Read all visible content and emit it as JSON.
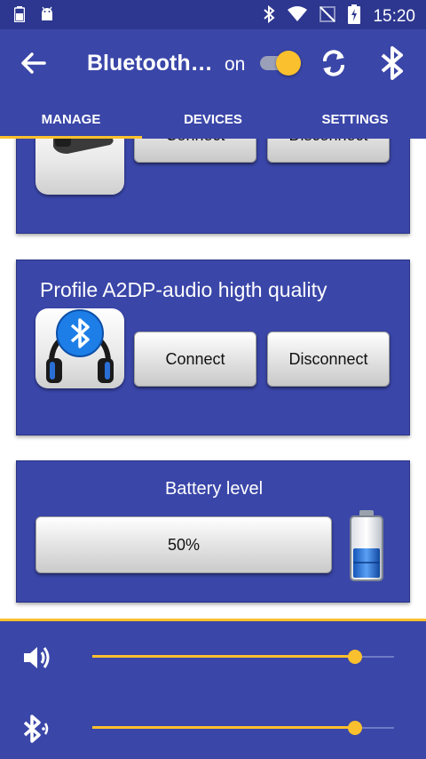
{
  "status_bar": {
    "time": "15:20",
    "icons": [
      "battery-icon",
      "android-icon",
      "bluetooth-icon",
      "wifi-icon",
      "no-sim-icon",
      "charging-battery-icon"
    ]
  },
  "app_bar": {
    "title": "Bluetooth…",
    "power_label": "on",
    "power_on": true,
    "icons": [
      "back-arrow-icon",
      "refresh-icon",
      "bluetooth-icon"
    ]
  },
  "tabs": [
    {
      "label": "MANAGE",
      "selected": true
    },
    {
      "label": "DEVICES",
      "selected": false
    },
    {
      "label": "SETTINGS",
      "selected": false
    }
  ],
  "profiles": [
    {
      "title": "",
      "icon": "headset-icon",
      "connect_label": "Connect",
      "disconnect_label": "Disconnect"
    },
    {
      "title": "Profile A2DP-audio higth quality",
      "icon": "bluetooth-headphones-icon",
      "connect_label": "Connect",
      "disconnect_label": "Disconnect"
    }
  ],
  "battery": {
    "title": "Battery level",
    "value_text": "50%",
    "level": 0.5
  },
  "controls": {
    "volume": {
      "icon": "speaker-icon",
      "level": 0.87
    },
    "bluetooth_volume": {
      "icon": "bluetooth-audio-icon",
      "level": 0.87
    }
  },
  "colors": {
    "primary": "#3a46a8",
    "status_bar": "#2d378f",
    "accent": "#fbc02d"
  }
}
